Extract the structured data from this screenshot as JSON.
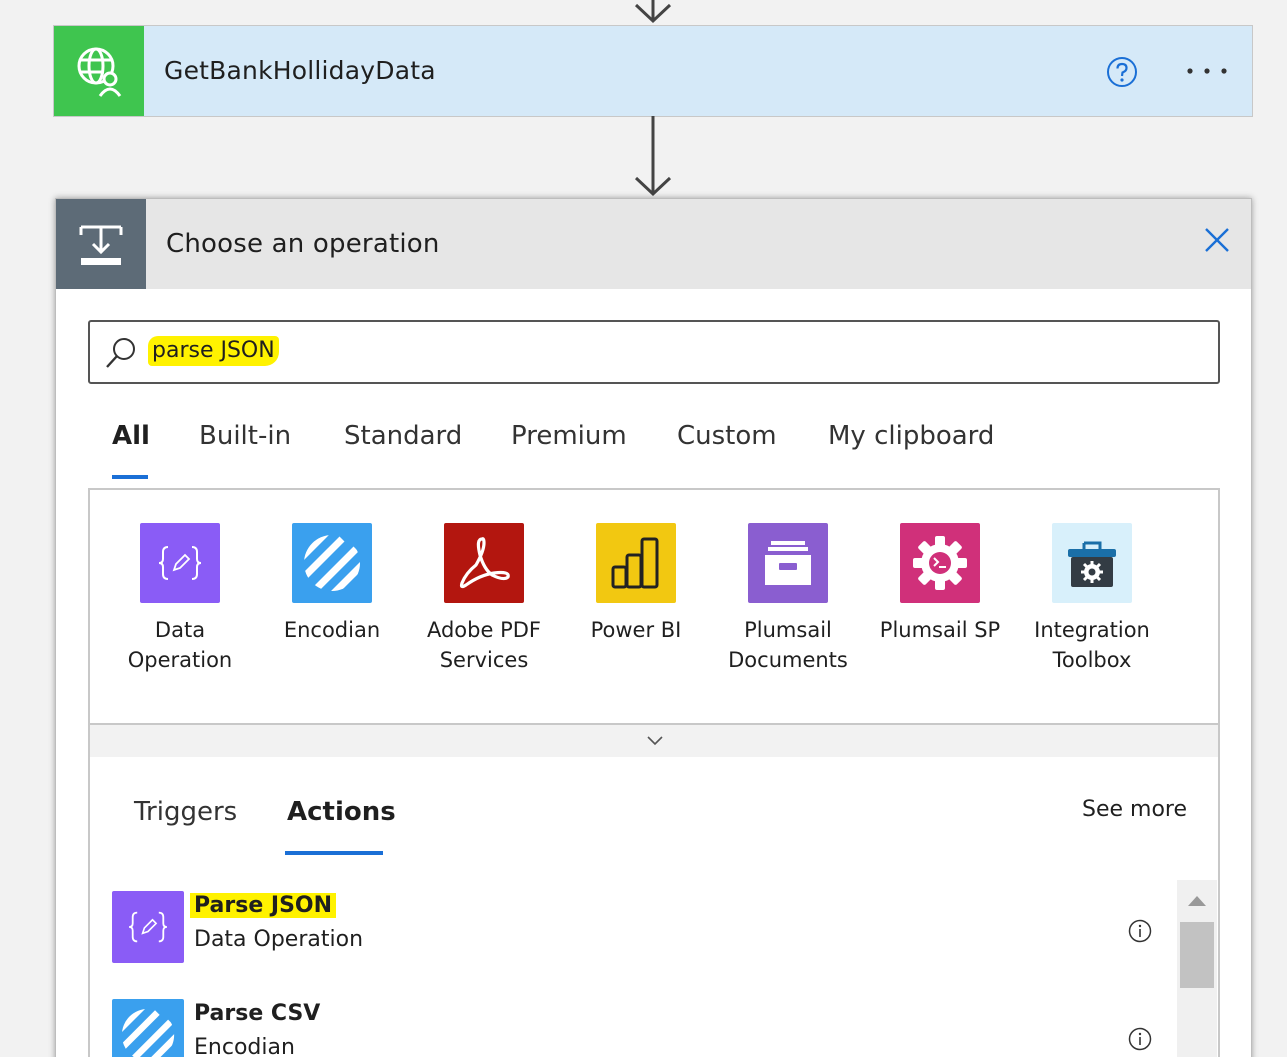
{
  "step": {
    "title": "GetBankHollidayData",
    "more_label": "...",
    "icon": "globe-user-icon",
    "color": "#3fc54f"
  },
  "operation": {
    "title": "Choose an operation",
    "icon": "operation-icon"
  },
  "search": {
    "value": "parse JSON"
  },
  "filter_tabs": [
    {
      "label": "All",
      "active": true
    },
    {
      "label": "Built-in"
    },
    {
      "label": "Standard"
    },
    {
      "label": "Premium"
    },
    {
      "label": "Custom"
    },
    {
      "label": "My clipboard"
    }
  ],
  "connectors": [
    {
      "label_line1": "Data",
      "label_line2": "Operation",
      "color": "#8a5cf6",
      "icon": "braces-icon"
    },
    {
      "label_line1": "Encodian",
      "label_line2": "",
      "color": "#3aa0ee",
      "icon": "stripes-icon"
    },
    {
      "label_line1": "Adobe PDF",
      "label_line2": "Services",
      "color": "#b3160f",
      "icon": "adobe-acrobat-icon"
    },
    {
      "label_line1": "Power BI",
      "label_line2": "",
      "color": "#f2c811",
      "icon": "bar-chart-icon"
    },
    {
      "label_line1": "Plumsail",
      "label_line2": "Documents",
      "color": "#8a5ed0",
      "icon": "archive-icon"
    },
    {
      "label_line1": "Plumsail SP",
      "label_line2": "",
      "color": "#d0307a",
      "icon": "gear-terminal-icon"
    },
    {
      "label_line1": "Integration",
      "label_line2": "Toolbox",
      "color": "#d8f0fb",
      "icon": "toolbox-gear-icon"
    }
  ],
  "results_tabs": {
    "triggers": "Triggers",
    "actions": "Actions",
    "see_more": "See more"
  },
  "results": [
    {
      "title": "Parse JSON",
      "subtitle": "Data Operation",
      "color": "#8a5cf6"
    },
    {
      "title": "Parse CSV",
      "subtitle": "Encodian",
      "color": "#3aa0ee"
    }
  ]
}
